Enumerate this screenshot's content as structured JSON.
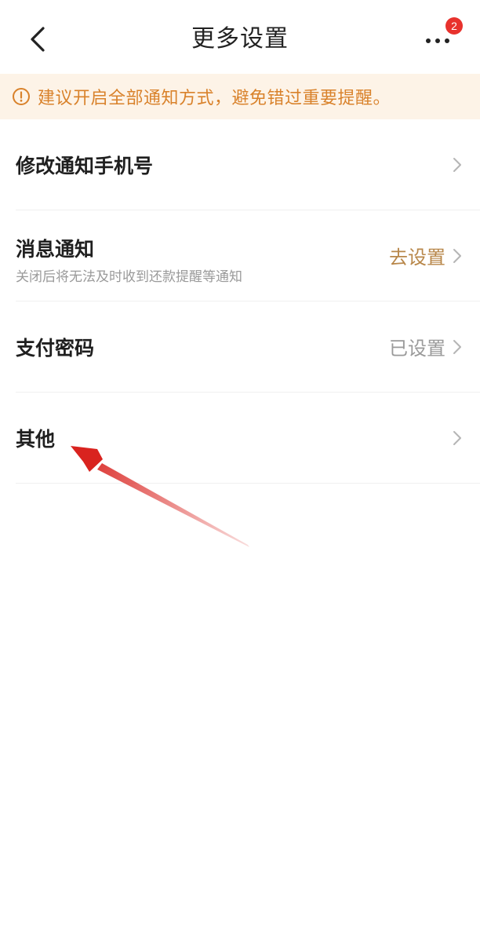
{
  "header": {
    "title": "更多设置",
    "badge_count": "2",
    "back_icon": "back-chevron-icon",
    "more_icon": "more-dots-icon"
  },
  "notice": {
    "text": "建议开启全部通知方式，避免错过重要提醒。",
    "icon": "info-circle-icon",
    "color": "#d9822b",
    "background": "#fdf3e7"
  },
  "settings": [
    {
      "title": "修改通知手机号",
      "subtitle": "",
      "value": ""
    },
    {
      "title": "消息通知",
      "subtitle": "关闭后将无法及时收到还款提醒等通知",
      "value": "去设置"
    },
    {
      "title": "支付密码",
      "subtitle": "",
      "value": "已设置"
    },
    {
      "title": "其他",
      "subtitle": "",
      "value": ""
    }
  ],
  "colors": {
    "accent_value": "#b8874a",
    "muted_value": "#9a9a9a",
    "badge": "#e8322d",
    "annotation_arrow": "#d9231f"
  }
}
